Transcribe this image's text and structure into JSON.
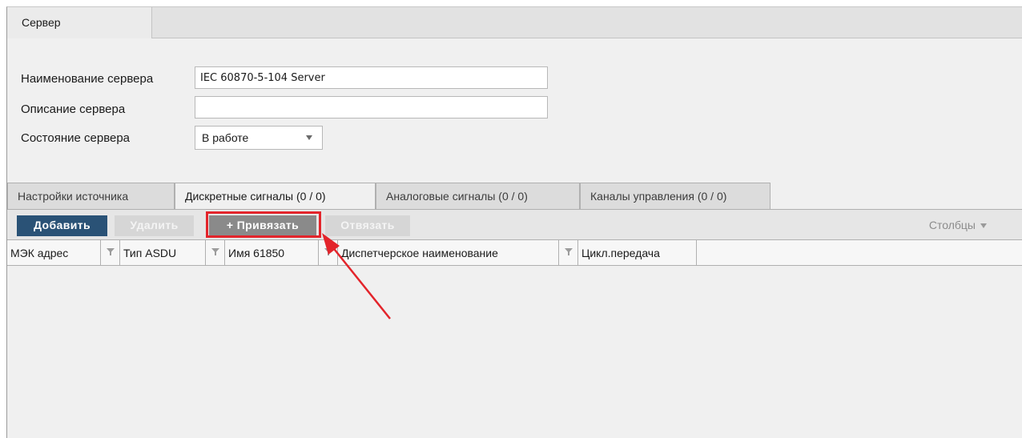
{
  "top_tab": {
    "label": "Сервер"
  },
  "form": {
    "name_label": "Наименование сервера",
    "name_value": "IEC 60870-5-104 Server",
    "description_label": "Описание сервера",
    "description_value": "",
    "state_label": "Состояние сервера",
    "state_value": "В работе"
  },
  "tabs": [
    {
      "label": "Настройки источника",
      "active": false
    },
    {
      "label": "Дискретные сигналы (0 / 0)",
      "active": true
    },
    {
      "label": "Аналоговые сигналы (0 / 0)",
      "active": false
    },
    {
      "label": "Каналы управления (0 / 0)",
      "active": false
    }
  ],
  "toolbar": {
    "add_label": "Добавить",
    "delete_label": "Удалить",
    "bind_label": "+ Привязать",
    "unbind_label": "Отвязать",
    "columns_label": "Столбцы"
  },
  "grid": {
    "columns": [
      "МЭК адрес",
      "Тип ASDU",
      "Имя 61850",
      "Диспетчерское наименование",
      "Цикл.передача"
    ],
    "rows": []
  },
  "colors": {
    "primary_button": "#2a5276",
    "highlight": "#e3242b",
    "annotation_arrow": "#e3242b"
  },
  "icons": {
    "filter": "filter-icon",
    "dropdown": "chevron-down-icon",
    "annotation": "arrow-icon"
  }
}
